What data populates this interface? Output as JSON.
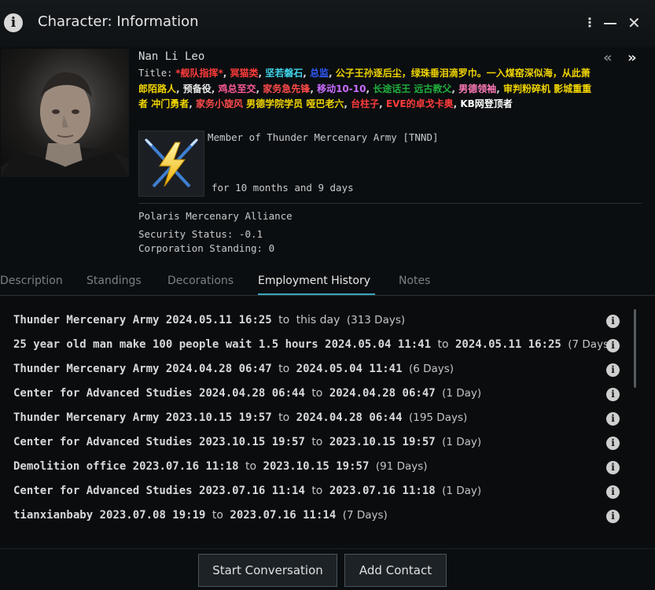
{
  "window": {
    "title": "Character: Information"
  },
  "character": {
    "name": "Nan Li Leo",
    "title_label": "Title:",
    "title_segments": [
      {
        "text": "*舰队指挥*",
        "color": "#ff3b3b"
      },
      {
        "text": ", ",
        "color": "#d0d0d0"
      },
      {
        "text": "冥猫类",
        "color": "#ff3b3b"
      },
      {
        "text": ", ",
        "color": "#d0d0d0"
      },
      {
        "text": "坚若磐石",
        "color": "#3fd2e8"
      },
      {
        "text": ", ",
        "color": "#d0d0d0"
      },
      {
        "text": "总监",
        "color": "#2f5bff"
      },
      {
        "text": ", ",
        "color": "#d0d0d0"
      },
      {
        "text": "公子王孙逐后尘，绿珠垂泪滴罗巾。一入煤窑深似海，从此萧郎陌路人",
        "color": "#f0d400"
      },
      {
        "text": ", ",
        "color": "#d0d0d0"
      },
      {
        "text": "预备役",
        "color": "#e8e8e8"
      },
      {
        "text": ", ",
        "color": "#d0d0d0"
      },
      {
        "text": "鸡总至交",
        "color": "#ff5a9a"
      },
      {
        "text": ", ",
        "color": "#d0d0d0"
      },
      {
        "text": "家务急先锋",
        "color": "#ff4a4a"
      },
      {
        "text": ", ",
        "color": "#d0d0d0"
      },
      {
        "text": "移动10-10",
        "color": "#c76bff"
      },
      {
        "text": ", ",
        "color": "#d0d0d0"
      },
      {
        "text": "长途话王",
        "color": "#1fae3c"
      },
      {
        "text": " ",
        "color": "#d0d0d0"
      },
      {
        "text": "远古教父",
        "color": "#1fae3c"
      },
      {
        "text": ", ",
        "color": "#d0d0d0"
      },
      {
        "text": "男德领袖",
        "color": "#ff7ab8"
      },
      {
        "text": ", ",
        "color": "#d0d0d0"
      },
      {
        "text": "审判粉碎机",
        "color": "#f0d400"
      },
      {
        "text": " ",
        "color": "#d0d0d0"
      },
      {
        "text": "影城重重者",
        "color": "#f0d400"
      },
      {
        "text": " ",
        "color": "#d0d0d0"
      },
      {
        "text": "冲门勇者",
        "color": "#f0d400"
      },
      {
        "text": ", ",
        "color": "#d0d0d0"
      },
      {
        "text": "家务小旋风",
        "color": "#ff4a4a"
      },
      {
        "text": " ",
        "color": "#d0d0d0"
      },
      {
        "text": "男德学院学员",
        "color": "#f0d400"
      },
      {
        "text": " ",
        "color": "#d0d0d0"
      },
      {
        "text": "哑巴老六",
        "color": "#f0d400"
      },
      {
        "text": ", ",
        "color": "#d0d0d0"
      },
      {
        "text": "台柱子",
        "color": "#ff3b3b"
      },
      {
        "text": ", ",
        "color": "#d0d0d0"
      },
      {
        "text": "EVE的卓戈卡奥",
        "color": "#ff3b3b"
      },
      {
        "text": ", ",
        "color": "#d0d0d0"
      },
      {
        "text": "KB网登顶者",
        "color": "#ffffff"
      }
    ],
    "corp_member": "Member of Thunder Mercenary Army [TNND]",
    "corp_duration": "for 10 months and 9 days",
    "alliance": "Polaris Mercenary Alliance",
    "security_status": "Security Status: -0.1",
    "corp_standing": "Corporation Standing: 0"
  },
  "tabs": [
    {
      "label": "Description"
    },
    {
      "label": "Standings"
    },
    {
      "label": "Decorations"
    },
    {
      "label": "Employment History"
    },
    {
      "label": "Notes"
    }
  ],
  "employment_history": [
    {
      "corp": "Thunder Mercenary Army",
      "start": "2024.05.11 16:25",
      "to": "to",
      "end": "this day",
      "days": "(313 Days)"
    },
    {
      "corp": "25 year old man make 100 people wait 1.5 hours",
      "start": "2024.05.04 11:41",
      "to": "to",
      "end": "2024.05.11 16:25",
      "days": "(7 Days)"
    },
    {
      "corp": "Thunder Mercenary Army",
      "start": "2024.04.28 06:47",
      "to": "to",
      "end": "2024.05.04 11:41",
      "days": "(6 Days)"
    },
    {
      "corp": "Center for Advanced Studies",
      "start": "2024.04.28 06:44",
      "to": "to",
      "end": "2024.04.28 06:47",
      "days": "(1 Day)"
    },
    {
      "corp": "Thunder Mercenary Army",
      "start": "2023.10.15 19:57",
      "to": "to",
      "end": "2024.04.28 06:44",
      "days": "(195 Days)"
    },
    {
      "corp": "Center for Advanced Studies",
      "start": "2023.10.15 19:57",
      "to": "to",
      "end": "2023.10.15 19:57",
      "days": "(1 Day)"
    },
    {
      "corp": "Demolition office",
      "start": "2023.07.16 11:18",
      "to": "to",
      "end": "2023.10.15 19:57",
      "days": "(91 Days)"
    },
    {
      "corp": "Center for Advanced Studies",
      "start": "2023.07.16 11:14",
      "to": "to",
      "end": "2023.07.16 11:18",
      "days": "(1 Day)"
    },
    {
      "corp": "tianxianbaby",
      "start": "2023.07.08 19:19",
      "to": "to",
      "end": "2023.07.16 11:14",
      "days": "(7 Days)"
    }
  ],
  "buttons": {
    "start_conversation": "Start Conversation",
    "add_contact": "Add Contact"
  },
  "icons": {
    "info": "i",
    "menu": "⋮",
    "close": "✕",
    "prev": "«",
    "next": "»"
  }
}
